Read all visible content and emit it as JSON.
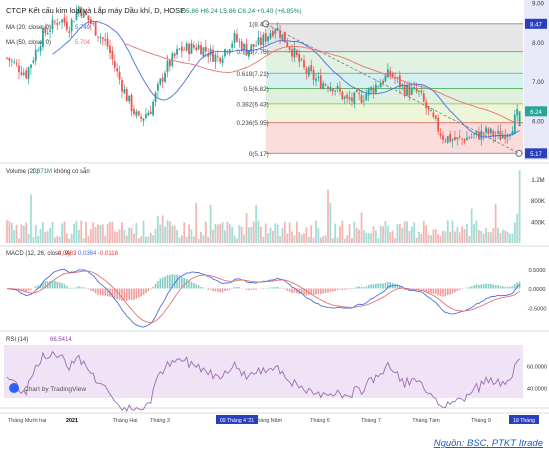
{
  "chart_data": {
    "type": "candlestick",
    "symbol_title": "CTCP Kết cấu kim loại và Lắp máy Dầu khí, D, HOSE",
    "ohlc": {
      "o": "5.86",
      "h": "6.24",
      "l": "5.86",
      "c": "6.24",
      "change": "+0.40 (+6.85%)"
    },
    "ma1": {
      "label": "MA (20, close, 0)",
      "value": "5.749"
    },
    "ma2": {
      "label": "MA (50, close, 0)",
      "value": "5.704"
    },
    "price_axis": {
      "ticks": [
        "9.00",
        "8.00",
        "7.00",
        "6.00"
      ],
      "ylim": [
        5.0,
        9.0
      ]
    },
    "price_badges": [
      "8.47",
      "6.24",
      "5.17"
    ],
    "fib_levels": [
      {
        "label": "1(8.47)",
        "value": 8.47,
        "fill": "#e6e6e6",
        "line": "#888888"
      },
      {
        "label": "0.786(7.76)",
        "value": 7.76,
        "fill": "#e2f2e2",
        "line": "#6a9a6a"
      },
      {
        "label": "0.618(7.21)",
        "value": 7.21,
        "fill": "#d6efef",
        "line": "#5aa0a0"
      },
      {
        "label": "0.5(6.82)",
        "value": 6.82,
        "fill": "#dff0df",
        "line": "#4caf50"
      },
      {
        "label": "0.382(6.43)",
        "value": 6.43,
        "fill": "#edf6d9",
        "line": "#8fbc3a"
      },
      {
        "label": "0.236(5.95)",
        "value": 5.95,
        "fill": "#fbdcdc",
        "line": "#d9534f"
      },
      {
        "label": "0(5.17)",
        "value": 5.17,
        "fill": "#ffffff",
        "line": "#888888"
      }
    ],
    "volume": {
      "label": "Volume (20)",
      "value": "1.371M",
      "note": "không có sẵn",
      "ticks": [
        "1.2M",
        "800K",
        "400K"
      ]
    },
    "macd": {
      "label": "MACD (12, 26, close, 9)",
      "v1": "0.0483",
      "v2": "0.0364",
      "v3": "-0.0118",
      "ticks": [
        "0.5000",
        "0.0000",
        "-0.5000"
      ]
    },
    "rsi": {
      "label": "RSI (14)",
      "value": "66.5414",
      "ticks": [
        "60.0000",
        "40.0000"
      ]
    },
    "x_ticks": [
      "Tháng Mười hai",
      "2021",
      "Tháng Hai",
      "Tháng 3",
      "09 Tháng 4 '21",
      "Tháng Năm",
      "Tháng 6",
      "Tháng 7",
      "Tháng Tám",
      "Tháng 9",
      "18 Tháng"
    ],
    "watermark": "Chart by TradingView",
    "colors": {
      "up": "#26a69a",
      "down": "#ef5350",
      "ma20": "#4a6fe3",
      "ma50": "#e57373"
    }
  },
  "source": "Nguồn: BSC, PTKT Itrade"
}
